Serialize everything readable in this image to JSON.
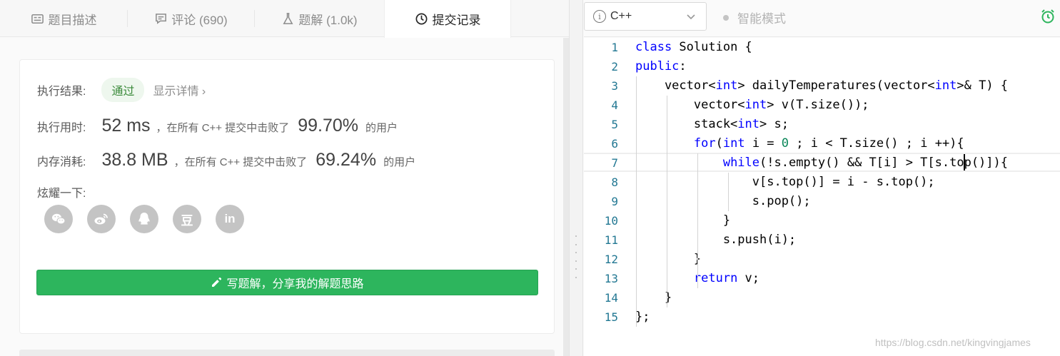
{
  "tabs": [
    {
      "label": "题目描述",
      "icon": "description-icon"
    },
    {
      "label": "评论 (690)",
      "icon": "comment-icon"
    },
    {
      "label": "题解 (1.0k)",
      "icon": "flask-icon"
    },
    {
      "label": "提交记录",
      "icon": "clock-icon",
      "active": true
    }
  ],
  "result": {
    "exec_label": "执行结果:",
    "status": "通过",
    "details_link": "显示详情 ›",
    "time_label": "执行用时:",
    "time_value": "52 ms",
    "time_text": "，在所有 C++ 提交中击败了",
    "time_pct": "99.70%",
    "time_suffix": "的用户",
    "mem_label": "内存消耗:",
    "mem_value": "38.8 MB",
    "mem_text": "，在所有 C++ 提交中击败了",
    "mem_pct": "69.24%",
    "mem_suffix": "的用户",
    "share_label": "炫耀一下:"
  },
  "share_buttons": [
    "wechat-icon",
    "weibo-icon",
    "qq-icon",
    "douban-icon",
    "linkedin-icon"
  ],
  "share_glyphs": {
    "douban": "豆",
    "linkedin": "in"
  },
  "write_button_label": "写题解，分享我的解题思路",
  "toolbar": {
    "language": "C++",
    "smart_mode": "智能模式"
  },
  "code": {
    "line_numbers": [
      "1",
      "2",
      "3",
      "4",
      "5",
      "6",
      "7",
      "8",
      "9",
      "10",
      "11",
      "12",
      "13",
      "14",
      "15"
    ]
  },
  "watermark": "https://blog.csdn.net/kingvingjames",
  "colors": {
    "accent_green": "#2db55d",
    "keyword": "#0000ff",
    "number": "#098658",
    "line_number": "#237893"
  }
}
